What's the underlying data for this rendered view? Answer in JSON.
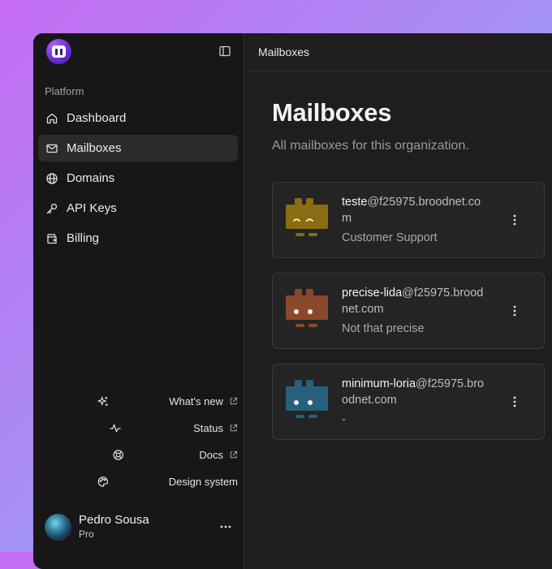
{
  "sidebar": {
    "section_label": "Platform",
    "nav": [
      {
        "label": "Dashboard",
        "icon": "home-icon",
        "active": false
      },
      {
        "label": "Mailboxes",
        "icon": "mail-icon",
        "active": true
      },
      {
        "label": "Domains",
        "icon": "globe-icon",
        "active": false
      },
      {
        "label": "API Keys",
        "icon": "key-icon",
        "active": false
      },
      {
        "label": "Billing",
        "icon": "wallet-icon",
        "active": false
      }
    ],
    "links": [
      {
        "label": "What's new",
        "icon": "sparkles-icon"
      },
      {
        "label": "Status",
        "icon": "activity-icon"
      },
      {
        "label": "Docs",
        "icon": "lifebuoy-icon"
      },
      {
        "label": "Design system",
        "icon": "palette-icon"
      }
    ],
    "user": {
      "name": "Pedro Sousa",
      "plan": "Pro"
    }
  },
  "topbar": {
    "title": "Mailboxes"
  },
  "page": {
    "title": "Mailboxes",
    "subtitle": "All mailboxes for this organization."
  },
  "mailboxes": [
    {
      "local": "teste",
      "domain": "@f25975.broodnet.com",
      "description": "Customer Support",
      "color": "#8a6c12",
      "eyes": "closed"
    },
    {
      "local": "precise-lida",
      "domain": "@f25975.broodnet.com",
      "description": "Not that precise",
      "color": "#8a4a2a",
      "eyes": "open"
    },
    {
      "local": "minimum-loria",
      "domain": "@f25975.broodnet.com",
      "description": "-",
      "color": "#26607c",
      "eyes": "open"
    }
  ],
  "colors": {
    "background_gradient_start": "#c46cf2",
    "background_gradient_end": "#86c3fb",
    "window_bg": "#1e1e1e",
    "sidebar_bg": "#171717",
    "active_item_bg": "#2b2b2b"
  }
}
